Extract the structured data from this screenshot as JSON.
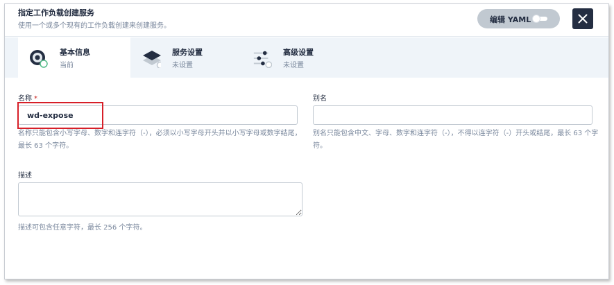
{
  "header": {
    "title": "指定工作负载创建服务",
    "subtitle": "使用一个或多个现有的工作负载创建来创建服务。",
    "yaml_toggle_label": "编辑 YAML",
    "yaml_toggle_on": false,
    "close_icon": "close-icon"
  },
  "tabs": [
    {
      "label": "基本信息",
      "status": "当前",
      "icon": "info-disc-icon"
    },
    {
      "label": "服务设置",
      "status": "未设置",
      "icon": "layers-icon"
    },
    {
      "label": "高级设置",
      "status": "未设置",
      "icon": "sliders-icon"
    }
  ],
  "form": {
    "name": {
      "label": "名称",
      "required_mark": "*",
      "value": "wd-expose",
      "help": "名称只能包含小写字母、数字和连字符（-），必须以小写字母开头并以小写字母或数字结尾，最长 63 个字符。"
    },
    "alias": {
      "label": "别名",
      "value": "",
      "help": "别名只能包含中文、字母、数字和连字符（-），不得以连字符（-）开头或结尾，最长 63 个字符。"
    },
    "description": {
      "label": "描述",
      "value": "",
      "help": "描述可包含任意字符，最长 256 个字符。"
    }
  },
  "colors": {
    "primary_dark": "#242e42",
    "tab_bar_bg": "#eff4f9",
    "success_green": "#55bc8a",
    "highlight_red": "#d71f28",
    "required_red": "#ca2621",
    "muted_text": "#79879c"
  }
}
